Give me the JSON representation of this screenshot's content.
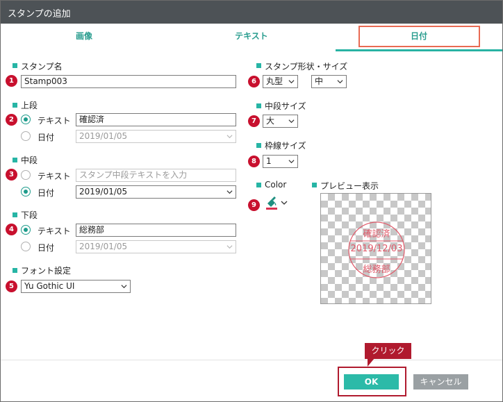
{
  "window": {
    "title": "スタンプの追加"
  },
  "tabs": [
    {
      "label": "画像"
    },
    {
      "label": "テキスト"
    },
    {
      "label": "日付"
    }
  ],
  "left": {
    "stamp_name": {
      "label": "スタンプ名",
      "value": "Stamp003",
      "badge": "1"
    },
    "upper": {
      "label": "上段",
      "badge": "2",
      "text_option": "テキスト",
      "text_value": "確認済",
      "date_option": "日付",
      "date_value": "2019/01/05",
      "selected": "text"
    },
    "middle": {
      "label": "中段",
      "badge": "3",
      "text_option": "テキスト",
      "text_placeholder": "スタンプ中段テキストを入力",
      "date_option": "日付",
      "date_value": "2019/01/05",
      "selected": "date"
    },
    "lower": {
      "label": "下段",
      "badge": "4",
      "text_option": "テキスト",
      "text_value": "総務部",
      "date_option": "日付",
      "date_value": "2019/01/05",
      "selected": "text"
    },
    "font": {
      "label": "フォント設定",
      "value": "Yu Gothic UI",
      "badge": "5"
    }
  },
  "right": {
    "shape_size": {
      "label": "スタンプ形状・サイズ",
      "shape": "丸型",
      "size": "中",
      "badge": "6"
    },
    "middle_size": {
      "label": "中段サイズ",
      "value": "大",
      "badge": "7"
    },
    "border_size": {
      "label": "枠線サイズ",
      "value": "1",
      "badge": "8"
    },
    "color": {
      "label": "Color",
      "badge": "9",
      "icon": "paint-bucket-icon",
      "value": "#d9304f"
    },
    "preview": {
      "label": "プレビュー表示",
      "stamp_top": "確認済",
      "stamp_middle": "2019/12/03",
      "stamp_bottom": "総務部",
      "stamp_color": "#e05a6a"
    }
  },
  "footer": {
    "ok_label": "OK",
    "cancel_label": "キャンセル",
    "callout": "クリック"
  },
  "colors": {
    "accent": "#28b3a3",
    "badge": "#c8102e",
    "titlebar": "#4d5256",
    "highlight_tab": "#e86a53",
    "highlight_ok": "#b01a2e"
  }
}
